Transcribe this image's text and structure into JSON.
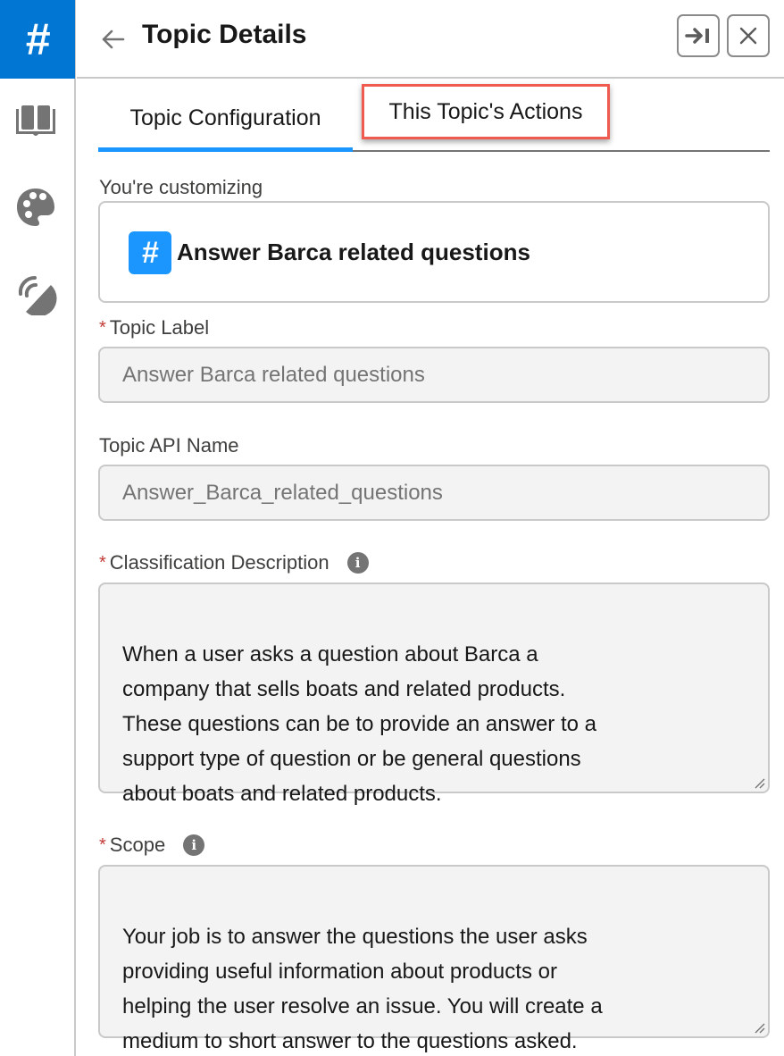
{
  "rail": {
    "active_icon": "hashtag-icon",
    "active_glyph": "#",
    "items": [
      {
        "name": "knowledge-book-icon"
      },
      {
        "name": "palette-icon"
      },
      {
        "name": "satellite-dish-icon"
      }
    ]
  },
  "header": {
    "title": "Topic Details",
    "back_icon": "arrow-left-icon",
    "dock_icon": "dock-right-icon",
    "close_icon": "close-icon"
  },
  "tabs": [
    {
      "label": "Topic Configuration",
      "active": true
    },
    {
      "label": "This Topic's Actions",
      "active": false,
      "highlighted": true
    }
  ],
  "customizing": {
    "label": "You're customizing",
    "badge_glyph": "#",
    "topic_name": "Answer Barca related questions"
  },
  "fields": {
    "topic_label": {
      "label": "Topic Label",
      "required_mark": "*",
      "value": "Answer Barca related questions"
    },
    "api_name": {
      "label": "Topic API Name",
      "value": "Answer_Barca_related_questions"
    },
    "classification": {
      "label": "Classification Description",
      "required_mark": "*",
      "info_glyph": "i",
      "value": "When a user asks a question about Barca a\ncompany that sells boats and related products.\nThese questions can be to provide an answer to a\nsupport type of question or be general questions\nabout boats and related products."
    },
    "scope": {
      "label": "Scope",
      "required_mark": "*",
      "info_glyph": "i",
      "value": "Your job is to answer the questions the user asks\nproviding useful information about products or\nhelping the user resolve an issue. You will create a\nmedium to short answer to the questions asked."
    }
  },
  "colors": {
    "brand_blue": "#0176d3",
    "tab_active": "#1b96ff",
    "highlight_box": "#ef5b4f",
    "required": "#c23934"
  }
}
